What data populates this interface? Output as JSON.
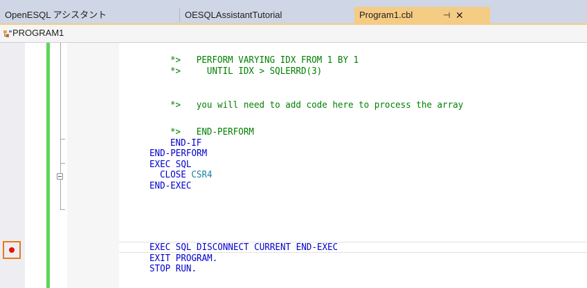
{
  "tabs": [
    {
      "label": "OpenESQL アシスタント",
      "active": false
    },
    {
      "label": "OESQLAssistantTutorial",
      "active": false
    },
    {
      "label": "Program1.cbl",
      "active": true,
      "pin_glyph": "⊣",
      "close_glyph": "✕"
    }
  ],
  "navigation": {
    "program": "PROGRAM1",
    "icon": "program-icon"
  },
  "colors": {
    "tab_strip": "#cfd6e5",
    "active_tab": "#f5cc84",
    "change_bar": "#5cd65c",
    "keyword": "#0000cc",
    "identifier": "#1a7fa0",
    "comment": "#008000",
    "breakpoint": "#e51400",
    "highlight_box": "#e8771a"
  },
  "editor": {
    "lines": [
      {
        "text": "*>   PERFORM VARYING IDX FROM 1 BY 1",
        "kind": "comment"
      },
      {
        "text": "*>     UNTIL IDX > SQLERRD(3)",
        "kind": "comment"
      },
      {
        "text": "*>   you will need to add code here to process the array",
        "kind": "comment"
      },
      {
        "text": "*>   END-PERFORM",
        "kind": "comment"
      },
      {
        "text": "END-IF",
        "kind": "keyword"
      },
      {
        "text": "END-PERFORM",
        "kind": "keyword"
      },
      {
        "text": "EXEC SQL",
        "kind": "keyword"
      },
      {
        "close": "CLOSE",
        "cursor": "CSR4",
        "kind": "mixed"
      },
      {
        "text": "END-EXEC",
        "kind": "keyword"
      },
      {
        "text": "EXEC SQL DISCONNECT CURRENT END-EXEC",
        "kind": "keyword"
      },
      {
        "text": "EXIT PROGRAM.",
        "kind": "keyword"
      },
      {
        "text": "STOP RUN.",
        "kind": "keyword"
      }
    ],
    "breakpoint": {
      "enabled": true
    }
  }
}
